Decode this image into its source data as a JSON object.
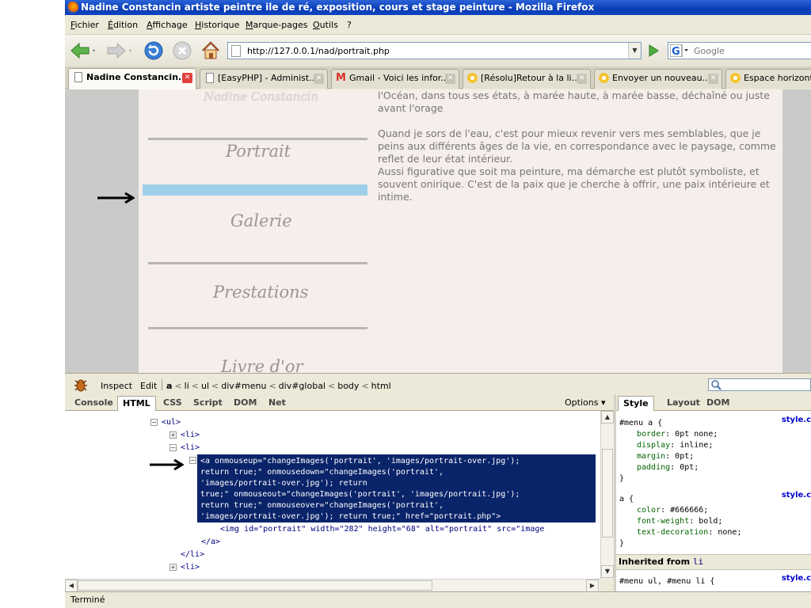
{
  "window": {
    "title": "Nadine Constancin artiste peintre ile de ré, exposition, cours et stage peinture - Mozilla Firefox"
  },
  "menubar": [
    "Fichier",
    "Édition",
    "Affichage",
    "Historique",
    "Marque-pages",
    "Outils",
    "?"
  ],
  "navbar": {
    "url": "http://127.0.0.1/nad/portrait.php",
    "search_placeholder": "Google"
  },
  "tabs": [
    {
      "label": "Nadine Constancin...",
      "active": true
    },
    {
      "label": "[EasyPHP] - Administ..."
    },
    {
      "label": "Gmail - Voici les infor..."
    },
    {
      "label": "[Résolu]Retour à la li..."
    },
    {
      "label": "Envoyer un nouveau..."
    },
    {
      "label": "Espace horizont"
    }
  ],
  "page": {
    "logo": "Nadine Constancin",
    "menu": [
      "Portrait",
      "Galerie",
      "Prestations",
      "Livre d'or"
    ],
    "paragraphs": [
      "l'Océan, dans tous ses états, à marée haute, à marée basse, déchaîné ou juste avant l'orage",
      "Quand je sors de l'eau, c'est pour mieux revenir vers mes semblables, que je peins aux différents âges de la vie, en correspondance avec le paysage, comme reflet de leur état intérieur.",
      "Aussi figurative que soit ma peinture, ma démarche est plutôt symboliste, et souvent onirique. C'est de la paix que je cherche à offrir, une paix intérieure et intime."
    ]
  },
  "firebug": {
    "toolbar": {
      "inspect": "Inspect",
      "edit": "Edit"
    },
    "breadcrumbs": [
      "a",
      "li",
      "ul",
      "div#menu",
      "div#global",
      "body",
      "html"
    ],
    "tabs": [
      "Console",
      "HTML",
      "CSS",
      "Script",
      "DOM",
      "Net"
    ],
    "active_tab": "HTML",
    "options": "Options ▾",
    "html_lines": {
      "ul": "<ul>",
      "li1": "<li>",
      "li2": "<li>",
      "selected": "<a onmouseup=\"changeImages('portrait', 'images/portrait-over.jpg');\nreturn true;\" onmousedown=\"changeImages('portrait',\n'images/portrait-over.jpg'); return\ntrue;\" onmouseout=\"changeImages('portrait', 'images/portrait.jpg');\nreturn true;\" onmouseover=\"changeImages('portrait',\n'images/portrait-over.jpg'); return true;\" href=\"portrait.php\">",
      "img": "<img id=\"portrait\" width=\"282\" height=\"68\" alt=\"portrait\" src=\"image",
      "a_close": "</a>",
      "li_close": "</li>",
      "li3": "<li>"
    },
    "side_tabs": [
      "Style",
      "Layout",
      "DOM"
    ],
    "side_active": "Style",
    "rules": [
      {
        "selector": "#menu a {",
        "source": "style.c",
        "props": [
          [
            "border",
            "0pt none;"
          ],
          [
            "display",
            "inline;"
          ],
          [
            "margin",
            "0pt;"
          ],
          [
            "padding",
            "0pt;"
          ]
        ]
      },
      {
        "selector": "a {",
        "source": "style.c",
        "props": [
          [
            "color",
            "#666666;"
          ],
          [
            "font-weight",
            "bold;"
          ],
          [
            "text-decoration",
            "none;"
          ]
        ]
      }
    ],
    "inherited_label": "Inherited from",
    "inherited_tag": "li",
    "inherited_rule": {
      "selector": "#menu ul, #menu li {",
      "source": "style.c"
    }
  },
  "status": "Terminé"
}
